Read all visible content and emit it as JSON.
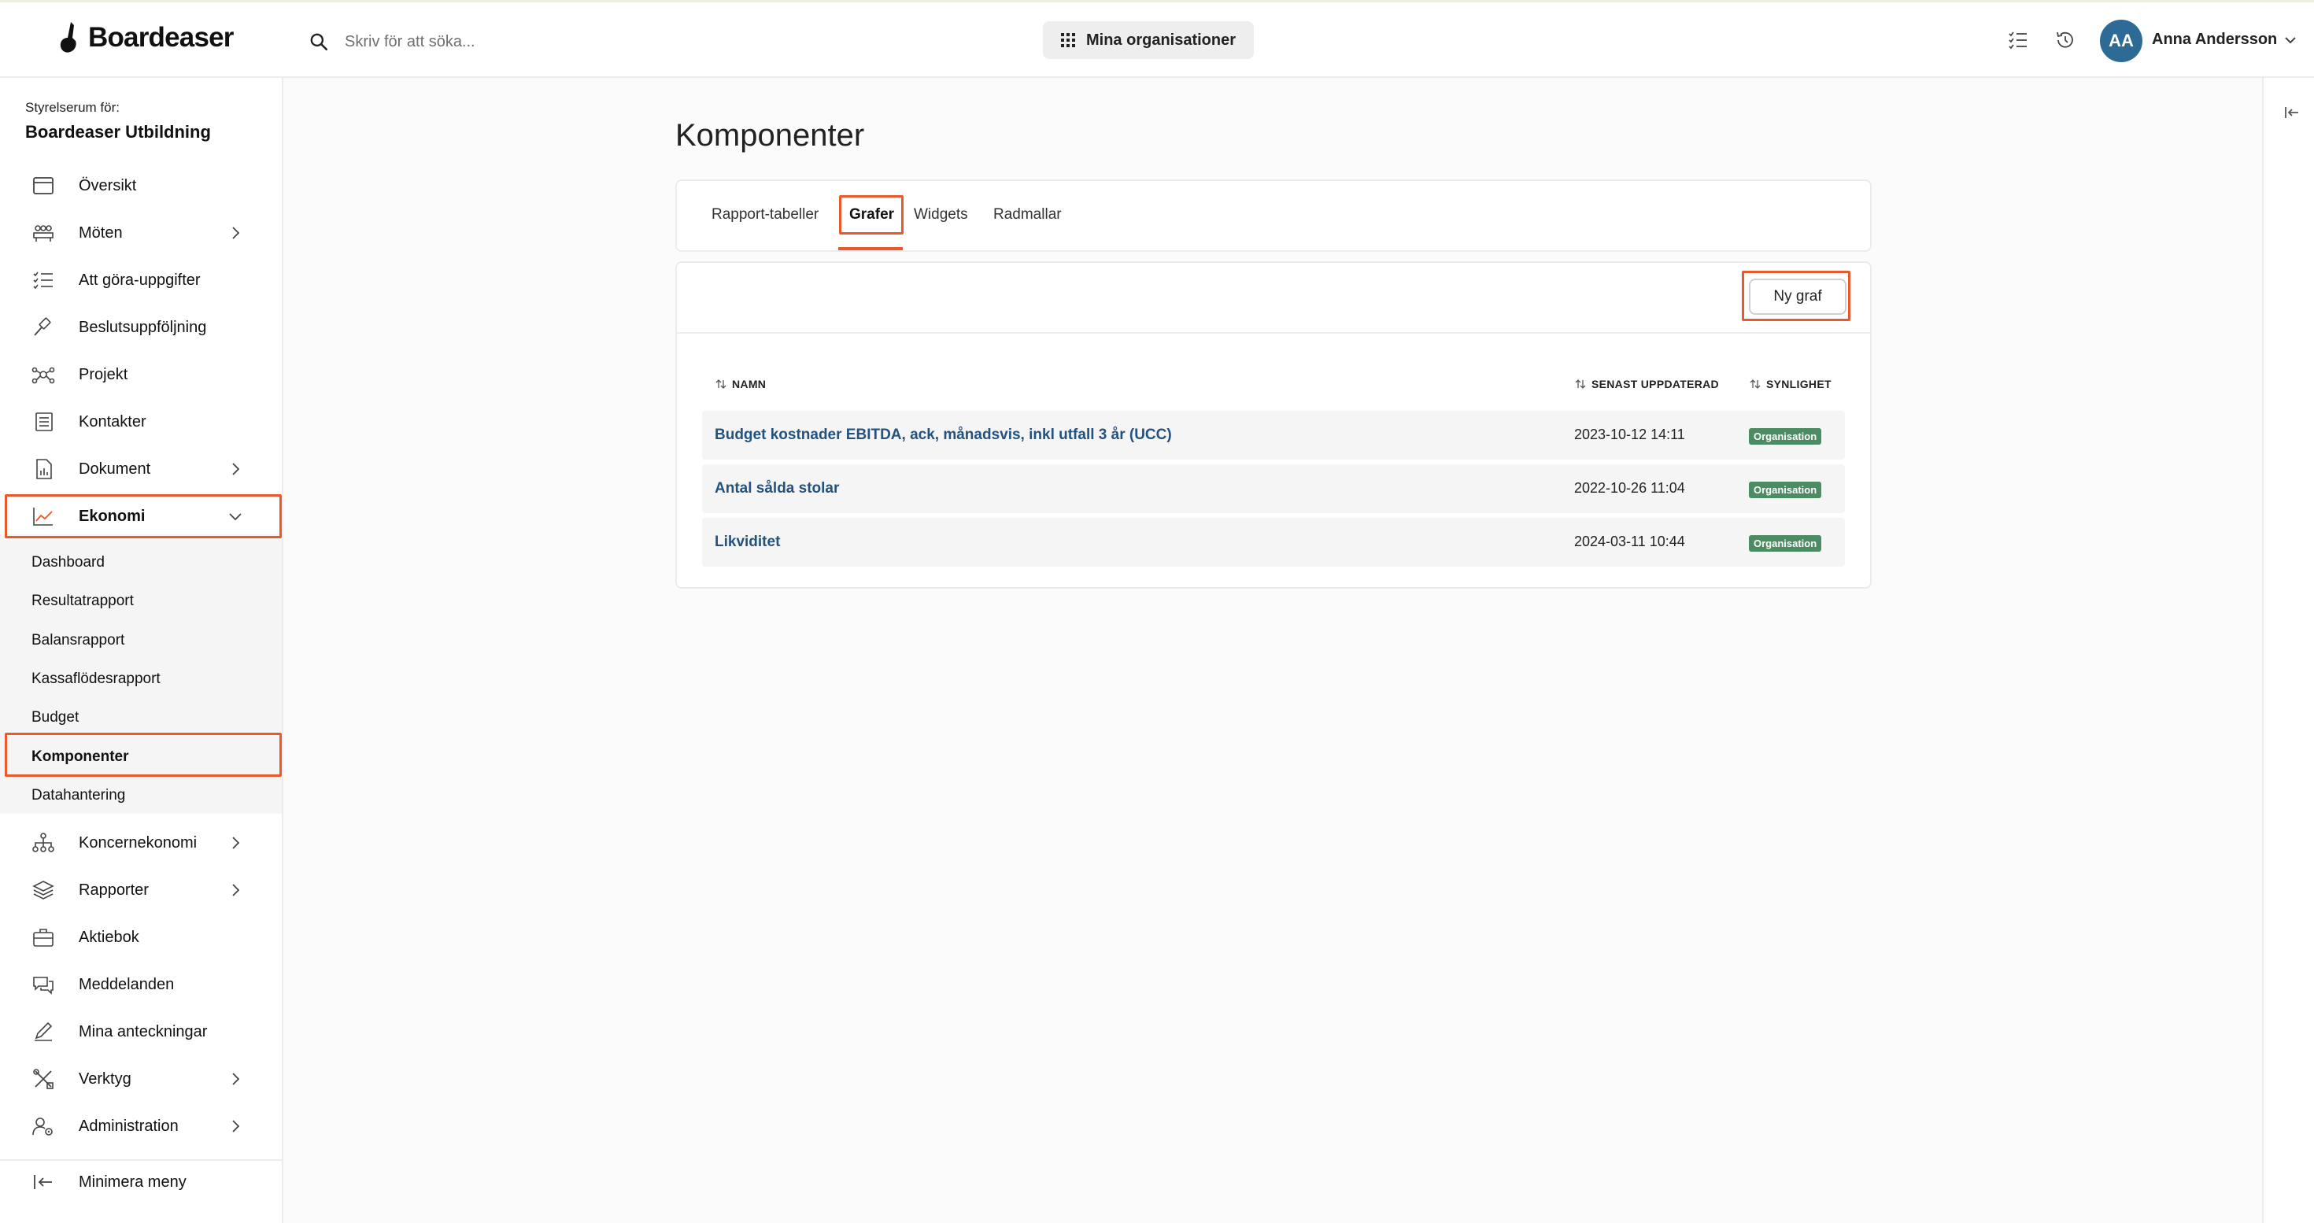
{
  "app": {
    "name": "Boardeaser"
  },
  "header": {
    "search_placeholder": "Skriv för att söka...",
    "org_button_label": "Mina organisationer",
    "user_initials": "AA",
    "user_name": "Anna Andersson"
  },
  "sidebar": {
    "context_label": "Styrelserum för:",
    "org_name": "Boardeaser Utbildning",
    "items": [
      {
        "label": "Översikt",
        "icon": "calendar-icon"
      },
      {
        "label": "Möten",
        "icon": "meeting-icon",
        "expandable": true
      },
      {
        "label": "Att göra-uppgifter",
        "icon": "checklist-icon"
      },
      {
        "label": "Beslutsuppföljning",
        "icon": "gavel-icon"
      },
      {
        "label": "Projekt",
        "icon": "network-icon"
      },
      {
        "label": "Kontakter",
        "icon": "contacts-icon"
      },
      {
        "label": "Dokument",
        "icon": "document-icon",
        "expandable": true
      },
      {
        "label": "Ekonomi",
        "icon": "chart-line-icon",
        "expandable": true,
        "expanded": true
      },
      {
        "label": "Koncernekonomi",
        "icon": "hierarchy-icon",
        "expandable": true
      },
      {
        "label": "Rapporter",
        "icon": "layers-icon",
        "expandable": true
      },
      {
        "label": "Aktiebok",
        "icon": "briefcase-icon"
      },
      {
        "label": "Meddelanden",
        "icon": "chat-icon"
      },
      {
        "label": "Mina anteckningar",
        "icon": "pencil-icon"
      },
      {
        "label": "Verktyg",
        "icon": "tools-icon",
        "expandable": true
      },
      {
        "label": "Administration",
        "icon": "admin-icon",
        "expandable": true
      }
    ],
    "ekonomi_sub": [
      "Dashboard",
      "Resultatrapport",
      "Balansrapport",
      "Kassaflödesrapport",
      "Budget",
      "Komponenter",
      "Datahantering"
    ],
    "active_sub": "Komponenter",
    "minimize_label": "Minimera meny"
  },
  "main": {
    "title": "Komponenter",
    "tabs": [
      "Rapport-tabeller",
      "Grafer",
      "Widgets",
      "Radmallar"
    ],
    "active_tab": "Grafer",
    "new_button": "Ny graf",
    "columns": [
      "NAMN",
      "SENAST UPPDATERAD",
      "SYNLIGHET"
    ],
    "rows": [
      {
        "name": "Budget kostnader EBITDA, ack, månadsvis, inkl utfall 3 år (UCC)",
        "updated": "2023-10-12 14:11",
        "visibility": "Organisation"
      },
      {
        "name": "Antal sålda stolar",
        "updated": "2022-10-26 11:04",
        "visibility": "Organisation"
      },
      {
        "name": "Likviditet",
        "updated": "2024-03-11 10:44",
        "visibility": "Organisation"
      }
    ]
  },
  "colors": {
    "accent": "#e8592b",
    "avatar": "#2e6a96",
    "badge": "#4c8c62",
    "link": "#24527f"
  }
}
